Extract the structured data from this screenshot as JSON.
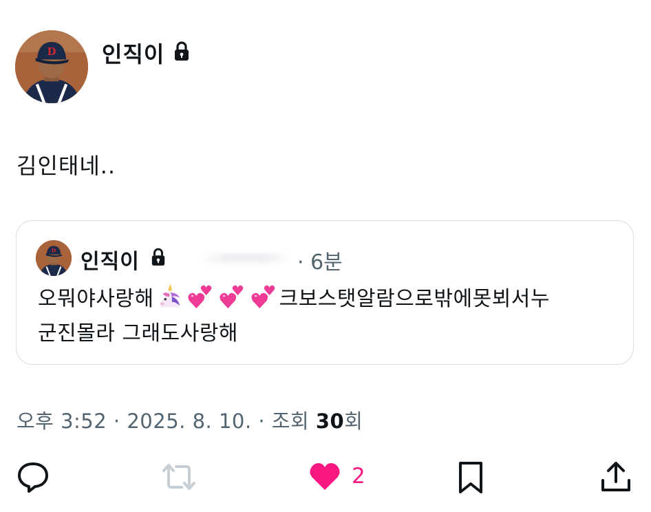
{
  "tweet": {
    "author_name": "인직이",
    "text": "김인태네..",
    "quote": {
      "author_name": "인직이",
      "time": "· 6분",
      "text_line1_start": "오뭐야사랑해",
      "text_line1_end": "크보스탯알람으로밖에못뵈서누",
      "text_line2": "군진몰라 그래도사랑해",
      "emojis": [
        "unicorn-emoji",
        "two-hearts-emoji",
        "two-hearts-emoji",
        "two-hearts-emoji"
      ]
    },
    "meta": {
      "time": "오후 3:52",
      "date": "· 2025. 8. 10. · 조회",
      "views": "30",
      "views_suffix": "회"
    },
    "actions": {
      "like_count": "2"
    }
  },
  "colors": {
    "text": "#0f1419",
    "secondary": "#536471",
    "like": "#f91880",
    "border": "#d8dde1"
  }
}
